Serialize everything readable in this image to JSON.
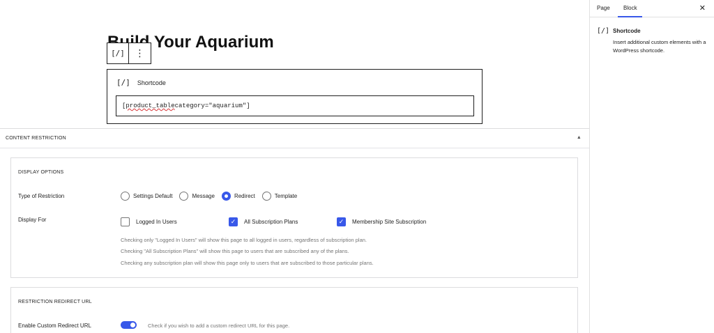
{
  "editor": {
    "post_title": "Build Your Aquarium",
    "toolbar": {
      "block_icon": "[/]",
      "options_icon": "⋮"
    },
    "shortcode_block": {
      "icon": "[/]",
      "label": "Shortcode",
      "value_prefix": "[",
      "value_underlined": "product_table",
      "value_suffix": " category=\"aquarium\"]"
    }
  },
  "content_restriction": {
    "header": "CONTENT RESTRICTION",
    "toggle_icon": "▲",
    "display_options": {
      "title": "DISPLAY OPTIONS",
      "type_label": "Type of Restriction",
      "type_options": [
        {
          "label": "Settings Default",
          "selected": false
        },
        {
          "label": "Message",
          "selected": false
        },
        {
          "label": "Redirect",
          "selected": true
        },
        {
          "label": "Template",
          "selected": false
        }
      ],
      "display_for_label": "Display For",
      "display_for_options": [
        {
          "label": "Logged In Users",
          "checked": false
        },
        {
          "label": "All Subscription Plans",
          "checked": true
        },
        {
          "label": "Membership Site Subscription",
          "checked": true
        }
      ],
      "help_lines": [
        "Checking only \"Logged In Users\" will show this page to all logged in users, regardless of subscription plan.",
        "Checking \"All Subscription Plans\" will show this page to users that are subscribed any of the plans.",
        "Checking any subscription plan will show this page only to users that are subscribed to those particular plans."
      ]
    },
    "redirect_url": {
      "title": "RESTRICTION REDIRECT URL",
      "enable_label": "Enable Custom Redirect URL",
      "enabled": true,
      "help": "Check if you wish to add a custom redirect URL for this page."
    }
  },
  "sidebar": {
    "tabs": [
      {
        "label": "Page",
        "active": false
      },
      {
        "label": "Block",
        "active": true
      }
    ],
    "close_icon": "✕",
    "block_card": {
      "icon": "[/]",
      "title": "Shortcode",
      "description": "Insert additional custom elements with a WordPress shortcode."
    }
  },
  "colors": {
    "accent": "#3858e9",
    "border": "#1e1e1e",
    "help_text": "#757575",
    "spellcheck": "#d63638"
  }
}
